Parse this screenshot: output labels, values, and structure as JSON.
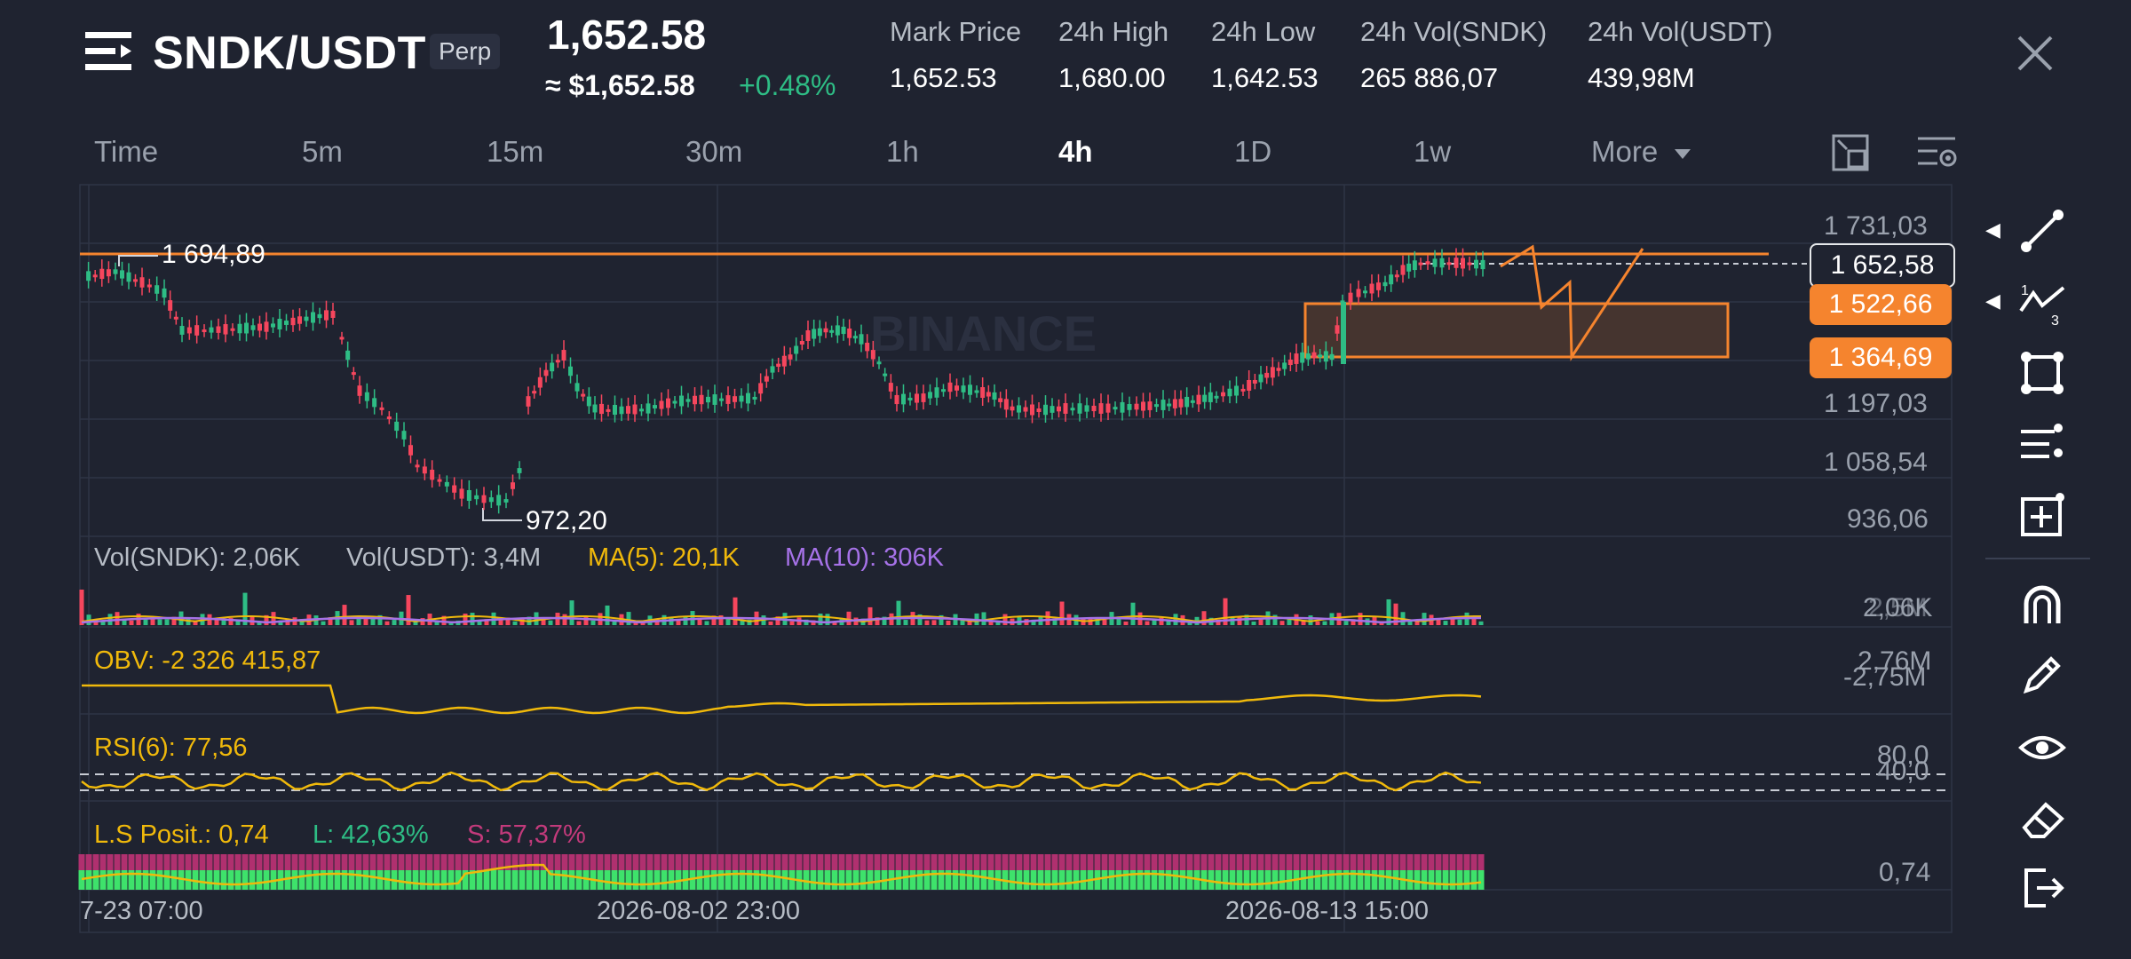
{
  "header": {
    "symbol": "SNDK/USDT",
    "badge": "Perp",
    "last_price": "1,652.58",
    "usd_price": "≈ $1,652.58",
    "change_pct": "+0.48%",
    "stats": [
      {
        "label": "Mark Price",
        "value": "1,652.53"
      },
      {
        "label": "24h High",
        "value": "1,680.00"
      },
      {
        "label": "24h Low",
        "value": "1,642.53"
      },
      {
        "label": "24h Vol(SNDK)",
        "value": "265 886,07"
      },
      {
        "label": "24h Vol(USDT)",
        "value": "439,98M"
      }
    ]
  },
  "intervals": [
    {
      "label": "Time",
      "active": false
    },
    {
      "label": "5m",
      "active": false
    },
    {
      "label": "15m",
      "active": false
    },
    {
      "label": "30m",
      "active": false
    },
    {
      "label": "1h",
      "active": false
    },
    {
      "label": "4h",
      "active": true
    },
    {
      "label": "1D",
      "active": false
    },
    {
      "label": "1w",
      "active": false
    },
    {
      "label": "More",
      "active": false
    }
  ],
  "chart": {
    "watermark": "BINANCE",
    "high_marker": "1 694,89",
    "low_marker": "972,20",
    "price_axis": [
      "1 731,03",
      "1 197,03",
      "1 058,54",
      "936,06"
    ],
    "current_price_badge": "1 652,58",
    "zone_badges": [
      "1 522,66",
      "1 364,69"
    ],
    "volume": {
      "vol_sndk": "Vol(SNDK): 2,06K",
      "vol_usdt": "Vol(USDT): 3,4M",
      "ma5": "MA(5): 20,1K",
      "ma10": "MA(10): 306K",
      "axis_a": "2,06K",
      "axis_b": "2,5M"
    },
    "obv": {
      "label": "OBV: -2 326 415,87",
      "axis_a": "2,76M",
      "axis_b": "-2,75M"
    },
    "rsi": {
      "label": "RSI(6): 77,56",
      "axis_a": "80,0",
      "axis_b": "40,0"
    },
    "ls": {
      "label": "L.S Posit.: 0,74",
      "long": "L: 42,63%",
      "short": "S: 57,37%",
      "axis_a": "0,74",
      "axis_b": "0,7"
    },
    "time_axis": [
      "7-23 07:00",
      "2026-08-02 23:00",
      "2026-08-13 15:00"
    ]
  },
  "colors": {
    "up": "#2ebd85",
    "down": "#f6465d",
    "accent": "#f5842e",
    "yellow": "#f0b90b",
    "purple": "#a672e8"
  }
}
